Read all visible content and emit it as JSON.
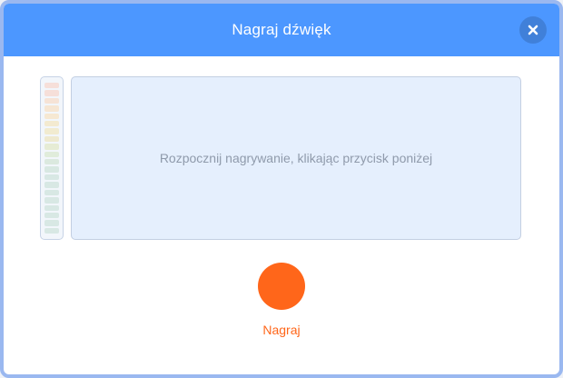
{
  "dialog": {
    "title": "Nagraj dźwięk",
    "close_icon": "close-icon"
  },
  "recorder": {
    "hint": "Rozpocznij nagrywanie, klikając przycisk poniżej",
    "record_label": "Nagraj",
    "record_icon": "record-circle",
    "level": 0
  },
  "meter": {
    "segments": [
      "#f6dfd9",
      "#f6dfd9",
      "#f6e3d6",
      "#f6e6d3",
      "#f6e8d2",
      "#f3ead0",
      "#f1ebd0",
      "#eee9cf",
      "#e6ecd5",
      "#e0ecdb",
      "#dbe9df",
      "#d8e8e2",
      "#d8e8e4",
      "#d8e8e4",
      "#d8e8e4",
      "#d8e8e4",
      "#d8e8e4",
      "#d8e8e4",
      "#d8e8e4",
      "#d8e8e4"
    ]
  },
  "colors": {
    "header": "#4c97ff",
    "accent": "#ff661a",
    "waveform_bg": "#e5effd"
  }
}
